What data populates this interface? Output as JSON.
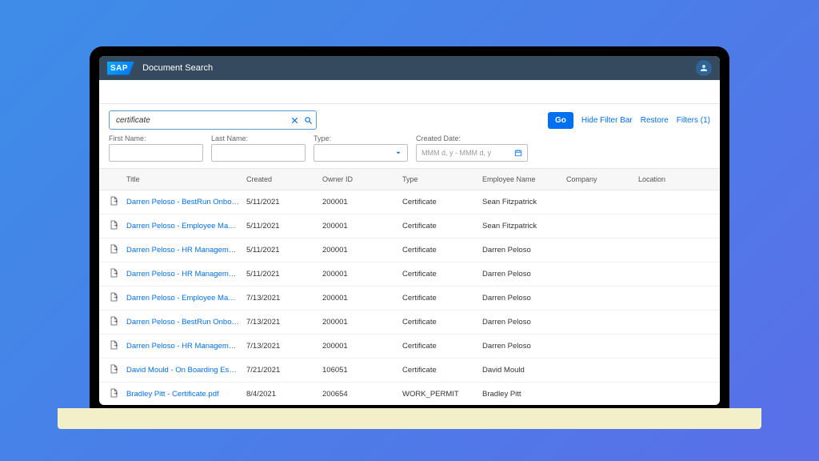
{
  "header": {
    "logo_text": "SAP",
    "app_title": "Document Search"
  },
  "filter": {
    "search_value": "certificate",
    "go_label": "Go",
    "hide_filter_label": "Hide Filter Bar",
    "restore_label": "Restore",
    "filters_label": "Filters (1)",
    "fields": {
      "first_name": {
        "label": "First Name:"
      },
      "last_name": {
        "label": "Last Name:"
      },
      "type": {
        "label": "Type:"
      },
      "created_date": {
        "label": "Created Date:",
        "placeholder": "MMM d, y - MMM d, y"
      }
    }
  },
  "table": {
    "headers": {
      "title": "Title",
      "created": "Created",
      "owner_id": "Owner ID",
      "type": "Type",
      "employee_name": "Employee Name",
      "company": "Company",
      "location": "Location"
    },
    "rows": [
      {
        "title": "Darren Peloso - BestRun Onboardin...",
        "created": "5/11/2021",
        "owner_id": "200001",
        "type": "Certificate",
        "employee": "Sean Fitzpatrick"
      },
      {
        "title": "Darren Peloso - Employee Manage...",
        "created": "5/11/2021",
        "owner_id": "200001",
        "type": "Certificate",
        "employee": "Sean Fitzpatrick"
      },
      {
        "title": "Darren Peloso - HR Management C...",
        "created": "5/11/2021",
        "owner_id": "200001",
        "type": "Certificate",
        "employee": "Darren Peloso"
      },
      {
        "title": "Darren Peloso - HR Management C...",
        "created": "5/11/2021",
        "owner_id": "200001",
        "type": "Certificate",
        "employee": "Darren Peloso"
      },
      {
        "title": "Darren Peloso - Employee Manage...",
        "created": "7/13/2021",
        "owner_id": "200001",
        "type": "Certificate",
        "employee": "Darren Peloso"
      },
      {
        "title": "Darren Peloso - BestRun Onboardin...",
        "created": "7/13/2021",
        "owner_id": "200001",
        "type": "Certificate",
        "employee": "Darren Peloso"
      },
      {
        "title": "Darren Peloso - HR Management C...",
        "created": "7/13/2021",
        "owner_id": "200001",
        "type": "Certificate",
        "employee": "Darren Peloso"
      },
      {
        "title": "David Mould - On Boarding Essenti...",
        "created": "7/21/2021",
        "owner_id": "106051",
        "type": "Certificate",
        "employee": "David Mould"
      },
      {
        "title": "Bradley Pitt - Certificate.pdf",
        "created": "8/4/2021",
        "owner_id": "200654",
        "type": "WORK_PERMIT",
        "employee": "Bradley Pitt"
      }
    ]
  }
}
